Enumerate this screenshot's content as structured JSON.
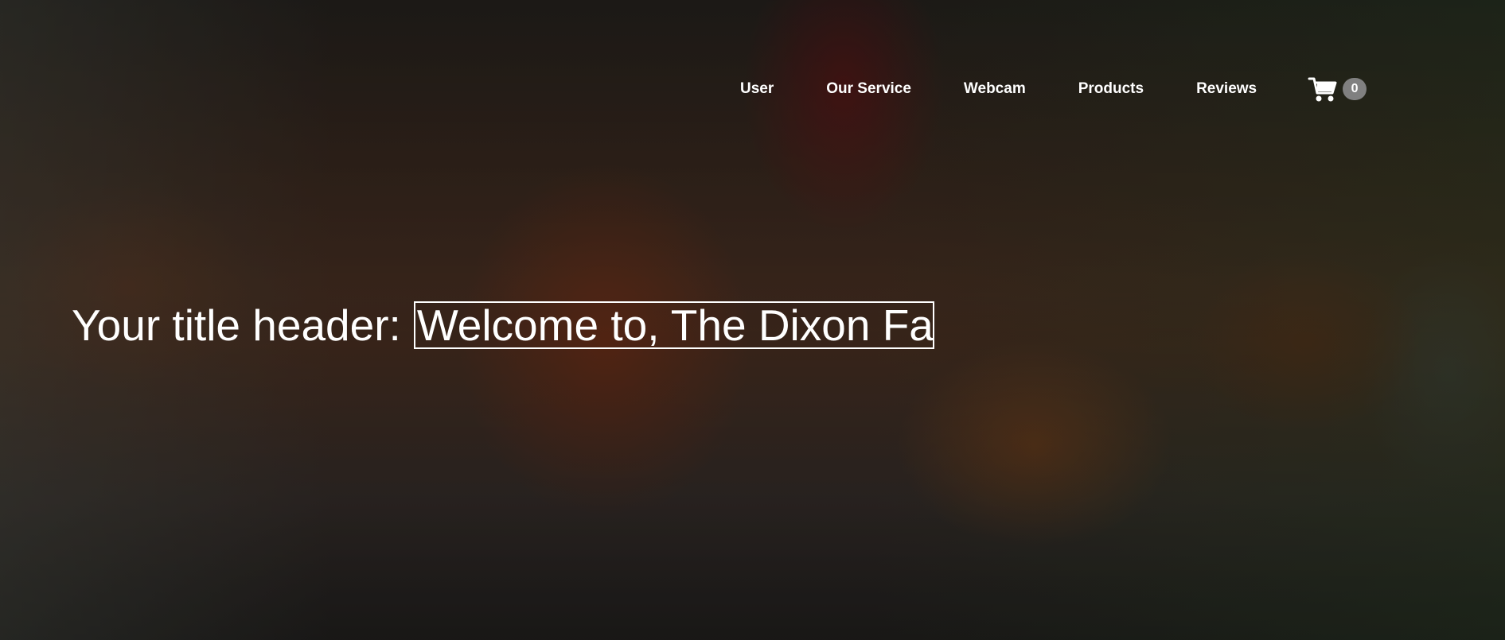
{
  "nav": {
    "items": [
      {
        "label": "User"
      },
      {
        "label": "Our Service"
      },
      {
        "label": "Webcam"
      },
      {
        "label": "Products"
      },
      {
        "label": "Reviews"
      }
    ]
  },
  "cart": {
    "icon": "cart-icon",
    "count": "0"
  },
  "hero": {
    "title_label": "Your title header:",
    "title_value": "Welcome to, The Dixon Far"
  },
  "colors": {
    "text": "#ffffff",
    "badge": "#808080"
  }
}
